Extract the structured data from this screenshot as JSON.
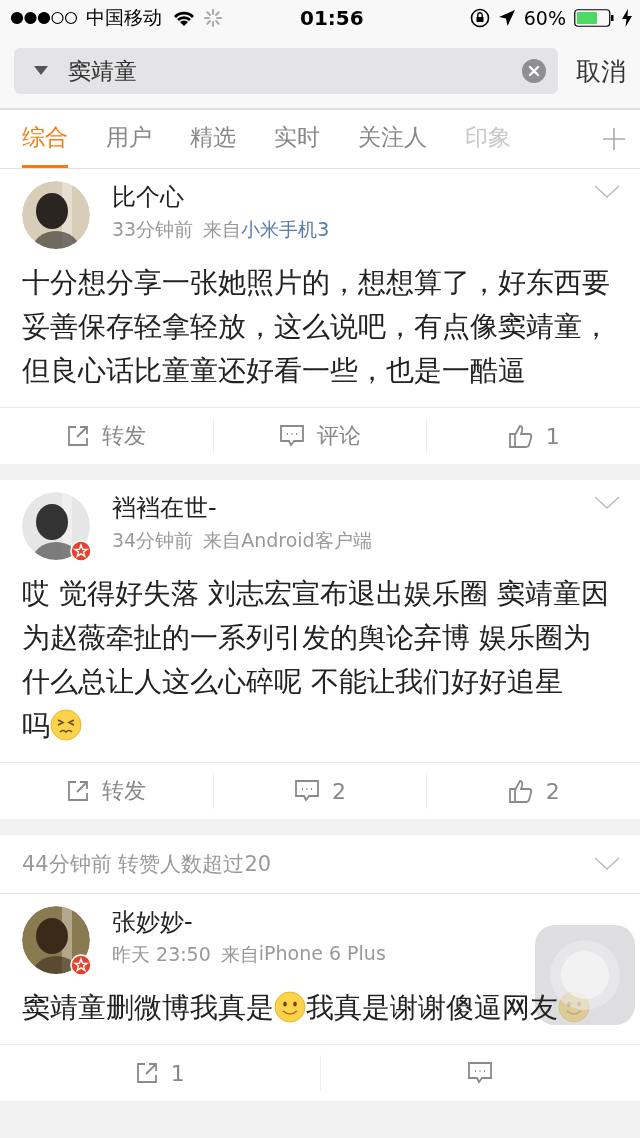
{
  "status_bar": {
    "carrier": "中国移动",
    "time": "01:56",
    "battery": "60%"
  },
  "search": {
    "value": "窦靖童",
    "cancel": "取消"
  },
  "tabs": [
    {
      "label": "综合",
      "selected": true,
      "faded": false
    },
    {
      "label": "用户",
      "selected": false,
      "faded": false
    },
    {
      "label": "精选",
      "selected": false,
      "faded": false
    },
    {
      "label": "实时",
      "selected": false,
      "faded": false
    },
    {
      "label": "关注人",
      "selected": false,
      "faded": false
    },
    {
      "label": "印象",
      "selected": false,
      "faded": true
    }
  ],
  "posts": [
    {
      "user": "比个心",
      "verified": false,
      "time": "33分钟前",
      "from": "来自",
      "source": "小米手机3",
      "source_link": true,
      "body": [
        {
          "kind": "text",
          "text": "十分想分享一张她照片的，想想算了，好东西要妥善保存轻拿轻放，这么说吧，有点像窦靖童，但良心话比童童还好看一些，也是一酷逼"
        }
      ],
      "actions": [
        {
          "kind": "repost",
          "label": "转发"
        },
        {
          "kind": "comment",
          "label": "评论"
        },
        {
          "kind": "like",
          "label": "1"
        }
      ]
    },
    {
      "user": "裆裆在世-",
      "verified": true,
      "time": "34分钟前",
      "from": "来自",
      "source": "Android客户端",
      "source_link": false,
      "body": [
        {
          "kind": "text",
          "text": "哎 觉得好失落 刘志宏宣布退出娱乐圈 窦靖童因为赵薇牵扯的一系列引发的舆论弃博 娱乐圈为什么总让人这么心碎呢 不能让我们好好追星"
        },
        {
          "kind": "text",
          "text": "吗"
        },
        {
          "kind": "persevere"
        }
      ],
      "actions": [
        {
          "kind": "repost",
          "label": "转发"
        },
        {
          "kind": "comment",
          "label": "2"
        },
        {
          "kind": "like",
          "label": "2"
        }
      ]
    },
    {
      "notice": "44分钟前 转赞人数超过20",
      "user": "张妙妙-",
      "verified": true,
      "time": "昨天 23:50",
      "from": "来自",
      "source": "iPhone 6 Plus",
      "source_link": false,
      "body": [
        {
          "kind": "text",
          "text": "窦靖童删微博我真是"
        },
        {
          "kind": "smile"
        },
        {
          "kind": "text",
          "text": "我真是谢谢傻逼网友"
        },
        {
          "kind": "smile"
        }
      ],
      "actions": [
        {
          "kind": "repost",
          "label": "1"
        },
        {
          "kind": "comment"
        }
      ]
    }
  ]
}
